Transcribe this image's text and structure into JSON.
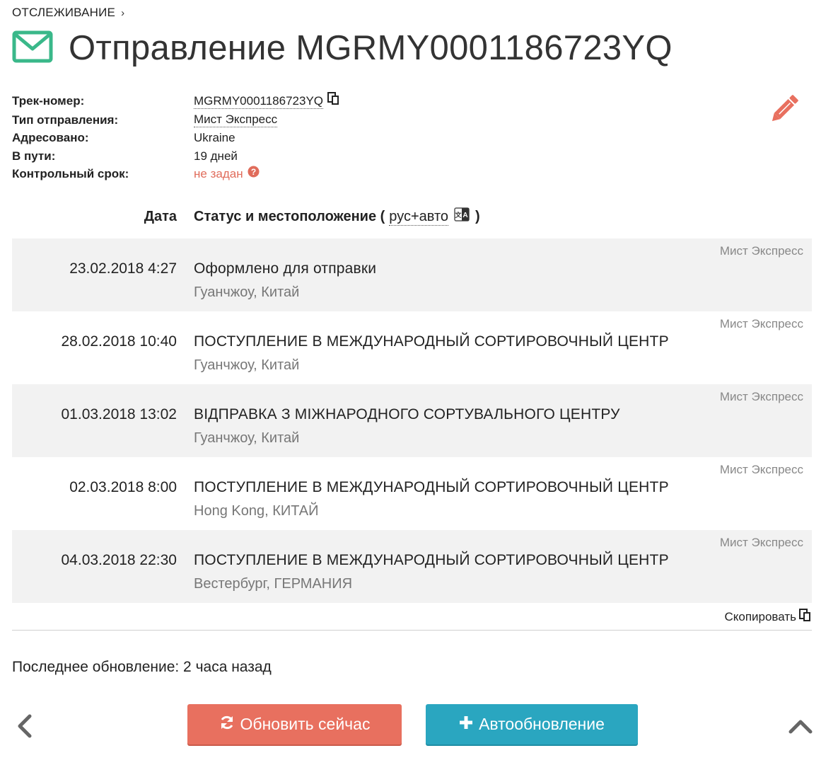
{
  "breadcrumb": {
    "label": "ОТСЛЕЖИВАНИЕ",
    "separator": "›"
  },
  "header": {
    "title": "Отправление MGRMY0001186723YQ",
    "icon": "envelope-icon",
    "icon_color": "#3ab88a"
  },
  "info": {
    "track_label": "Трек-номер:",
    "track_value": "MGRMY0001186723YQ",
    "type_label": "Тип отправления:",
    "type_value": "Мист Экспресс",
    "address_label": "Адресовано:",
    "address_value": "Ukraine",
    "transit_label": "В пути:",
    "transit_value": "19 дней",
    "deadline_label": "Контрольный срок:",
    "deadline_value": "не задан"
  },
  "table": {
    "date_header": "Дата",
    "status_header": "Статус и местоположение (",
    "lang_link": "рус+авто",
    "close_paren": ")",
    "events": [
      {
        "date": "23.02.2018 4:27",
        "status": "Оформлено для отправки",
        "location": "Гуанчжоу, Китай",
        "carrier": "Мист Экспресс"
      },
      {
        "date": "28.02.2018 10:40",
        "status": "ПОСТУПЛЕНИЕ В МЕЖДУНАРОДНЫЙ СОРТИРОВОЧНЫЙ ЦЕНТР",
        "location": "Гуанчжоу, Китай",
        "carrier": "Мист Экспресс"
      },
      {
        "date": "01.03.2018 13:02",
        "status": "ВІДПРАВКА З МІЖНАРОДНОГО СОРТУВАЛЬНОГО ЦЕНТРУ",
        "location": "Гуанчжоу, Китай",
        "carrier": "Мист Экспресс"
      },
      {
        "date": "02.03.2018 8:00",
        "status": "ПОСТУПЛЕНИЕ В МЕЖДУНАРОДНЫЙ СОРТИРОВОЧНЫЙ ЦЕНТР",
        "location": "Hong Kong, КИТАЙ",
        "carrier": "Мист Экспресс"
      },
      {
        "date": "04.03.2018 22:30",
        "status": "ПОСТУПЛЕНИЕ В МЕЖДУНАРОДНЫЙ СОРТИРОВОЧНЫЙ ЦЕНТР",
        "location": "Вестербург, ГЕРМАНИЯ",
        "carrier": "Мист Экспресс"
      }
    ]
  },
  "copy_label": "Скопировать",
  "last_update": "Последнее обновление: 2 часа назад",
  "buttons": {
    "refresh": "Обновить сейчас",
    "auto": "Автообновление"
  },
  "colors": {
    "accent_red": "#e8705f",
    "accent_blue": "#2aa6c0",
    "green": "#3ab88a"
  }
}
